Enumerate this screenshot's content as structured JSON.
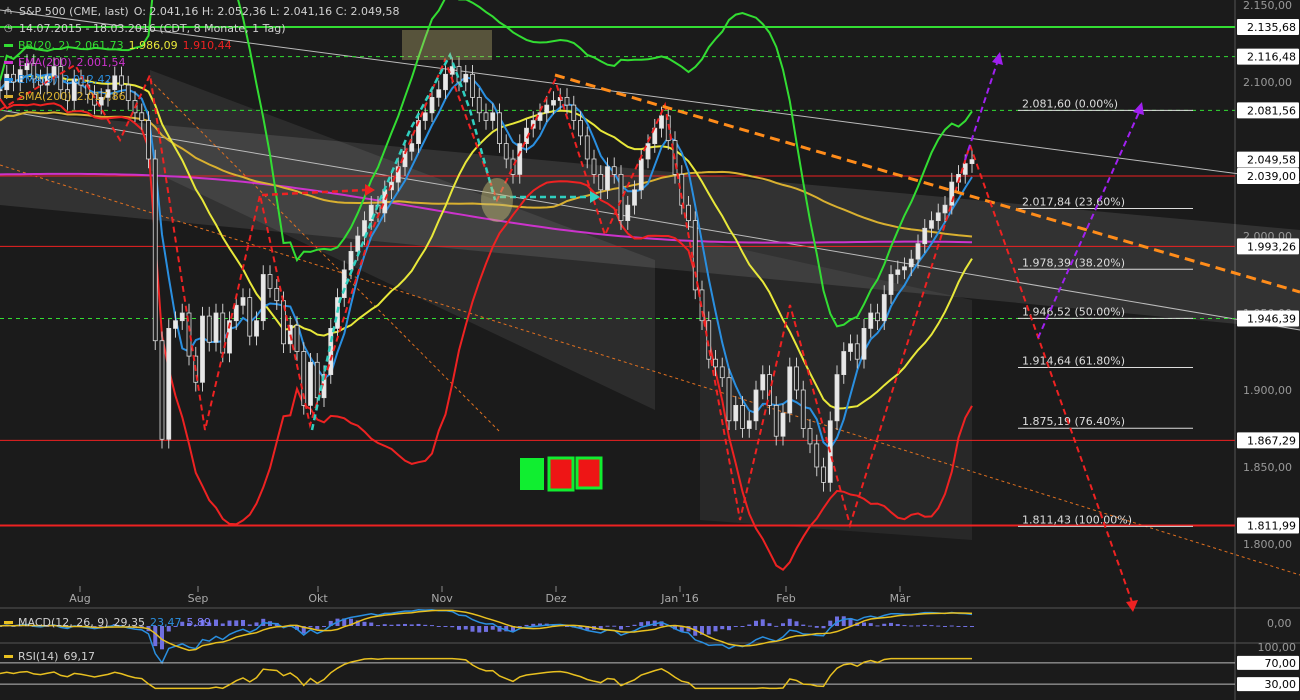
{
  "header": {
    "title": "S&P 500 (CME, last)",
    "ohlc": "O: 2.041,16  H: 2.052,36  L: 2.041,16  C: 2.049,58",
    "range": "14.07.2015 - 18.03.2016 (CDT, 8 Monate, 1 Tag)"
  },
  "indicators": [
    {
      "label": "BB(20, 2)",
      "values": [
        {
          "v": "2.061,73",
          "color": "#33dd33"
        },
        {
          "v": "1.986,09",
          "color": "#e8e83a"
        },
        {
          "v": "1.910,44",
          "color": "#ee2222"
        }
      ],
      "color": "#33dd33"
    },
    {
      "label": "EMA(200)",
      "values": [
        {
          "v": "2.001,54",
          "color": "#cc33cc"
        }
      ],
      "color": "#cc33cc"
    },
    {
      "label": "EMA(9)",
      "values": [
        {
          "v": "2.012,42",
          "color": "#2a8fe0"
        }
      ],
      "color": "#2a8fe0"
    },
    {
      "label": "SMA(200)",
      "values": [
        {
          "v": "2.017,86",
          "color": "#d9b030"
        }
      ],
      "color": "#d9b030"
    }
  ],
  "macd": {
    "label": "MACD(12, 26, 9)",
    "values": [
      {
        "v": "29,35",
        "color": "#d0d0d0"
      },
      {
        "v": "23,47",
        "color": "#2a8fe0"
      },
      {
        "v": "5,89",
        "color": "#8080ff"
      }
    ],
    "color": "#e8c020"
  },
  "rsi": {
    "label": "RSI(14)",
    "values": [
      {
        "v": "69,17",
        "color": "#d0d0d0"
      }
    ],
    "color": "#e8c020"
  },
  "chart_data": {
    "type": "candlestick",
    "y_axis_ticks": [
      "2.150,00",
      "2.100,00",
      "2.050,00",
      "2.000,00",
      "1.950,00",
      "1.900,00",
      "1.850,00",
      "1.800,00"
    ],
    "x_axis_ticks": [
      "Aug",
      "Sep",
      "Okt",
      "Nov",
      "Dez",
      "Jan '16",
      "Feb",
      "Mär"
    ],
    "price_tags": [
      {
        "value": 2135.68,
        "label": "2.135,68",
        "color": "#33dd33"
      },
      {
        "value": 2116.48,
        "label": "2.116,48",
        "color": "#33dd33"
      },
      {
        "value": 2081.56,
        "label": "2.081,56",
        "color": "#33dd33"
      },
      {
        "value": 2049.58,
        "label": "2.049,58",
        "color": "#ffffff"
      },
      {
        "value": 2039.0,
        "label": "2.039,00",
        "color": "#ee2222"
      },
      {
        "value": 1993.26,
        "label": "1.993,26",
        "color": "#ee2222"
      },
      {
        "value": 1946.39,
        "label": "1.946,39",
        "color": "#33dd33"
      },
      {
        "value": 1867.29,
        "label": "1.867,29",
        "color": "#ee2222"
      },
      {
        "value": 1811.99,
        "label": "1.811,99",
        "color": "#ee2222"
      }
    ],
    "fibonacci": [
      {
        "value": 2081.6,
        "label": "2.081,60 (0.00%)"
      },
      {
        "value": 2017.84,
        "label": "2.017,84 (23.60%)"
      },
      {
        "value": 1978.39,
        "label": "1.978,39 (38.20%)"
      },
      {
        "value": 1946.52,
        "label": "1.946,52 (50.00%)"
      },
      {
        "value": 1914.64,
        "label": "1.914,64 (61.80%)"
      },
      {
        "value": 1875.19,
        "label": "1.875,19 (76.40%)"
      },
      {
        "value": 1811.43,
        "label": "1.811,43 (100.00%)"
      }
    ],
    "closes": [
      2095,
      2105,
      2100,
      2108,
      2112,
      2102,
      2098,
      2104,
      2110,
      2095,
      2088,
      2102,
      2098,
      2092,
      2085,
      2090,
      2095,
      2104,
      2098,
      2088,
      2080,
      2075,
      2050,
      1932,
      1868,
      1940,
      1945,
      1950,
      1922,
      1905,
      1948,
      1931,
      1950,
      1924,
      1945,
      1955,
      1960,
      1935,
      1945,
      1975,
      1966,
      1958,
      1930,
      1942,
      1925,
      1890,
      1918,
      1895,
      1910,
      1940,
      1960,
      1978,
      1990,
      2000,
      2010,
      2020,
      2015,
      2030,
      2035,
      2045,
      2055,
      2060,
      2075,
      2080,
      2090,
      2095,
      2105,
      2110,
      2100,
      2105,
      2090,
      2080,
      2075,
      2080,
      2060,
      2050,
      2040,
      2060,
      2070,
      2075,
      2080,
      2085,
      2088,
      2090,
      2085,
      2075,
      2065,
      2050,
      2040,
      2030,
      2045,
      2040,
      2010,
      2020,
      2030,
      2050,
      2060,
      2070,
      2078,
      2062,
      2040,
      2020,
      2010,
      1965,
      1945,
      1920,
      1915,
      1908,
      1880,
      1890,
      1875,
      1880,
      1900,
      1910,
      1890,
      1870,
      1885,
      1915,
      1900,
      1875,
      1865,
      1850,
      1840,
      1880,
      1910,
      1925,
      1930,
      1920,
      1940,
      1950,
      1945,
      1962,
      1975,
      1978,
      1980,
      1985,
      1995,
      2005,
      2010,
      2015,
      2020,
      2035,
      2040,
      2047,
      2049.58
    ],
    "series_last": {
      "BB(20, 2) upper": 2061.73,
      "BB(20, 2) middle": 1986.09,
      "BB(20, 2) lower": 1910.44,
      "EMA(200)": 2001.54,
      "EMA(9)": 2012.42,
      "SMA(200)": 2017.86
    },
    "macd_axis_tick": "0,00",
    "rsi_axis_ticks": [
      "100,00",
      "70,00",
      "30,00"
    ],
    "rsi_last": 69.17
  }
}
